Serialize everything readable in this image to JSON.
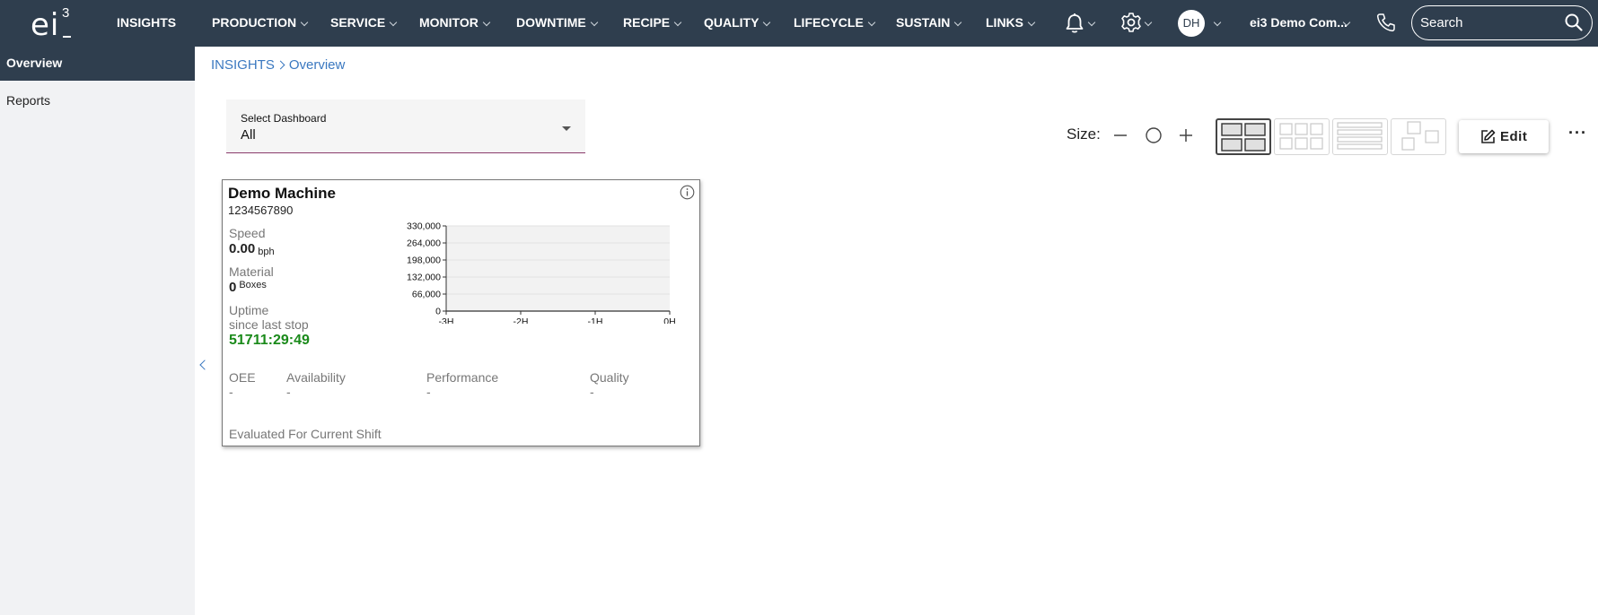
{
  "nav": {
    "brand_letters": "ei",
    "brand_superscript": "3",
    "items": [
      "INSIGHTS",
      "PRODUCTION",
      "SERVICE",
      "MONITOR",
      "DOWNTIME",
      "RECIPE",
      "QUALITY",
      "LIFECYCLE",
      "SUSTAIN",
      "LINKS"
    ],
    "avatar_initials": "DH",
    "company": "ei3 Demo Com...",
    "search_placeholder": "Search"
  },
  "sidebar": {
    "items": [
      "Overview",
      "Reports"
    ]
  },
  "breadcrumb": {
    "root": "INSIGHTS",
    "current": "Overview"
  },
  "dashboard_select": {
    "label": "Select Dashboard",
    "value": "All"
  },
  "toolbar": {
    "size_label": "Size:",
    "edit_label": "Edit",
    "more_label": "···"
  },
  "card": {
    "title": "Demo Machine",
    "serial": "1234567890",
    "speed_label": "Speed",
    "speed_value": "0.00",
    "speed_unit": "bph",
    "material_label": "Material",
    "material_value": "0",
    "material_unit": "Boxes",
    "uptime_label": "Uptime",
    "uptime_sub": "since last stop",
    "uptime_value": "51711:29:49",
    "oee": [
      {
        "label": "OEE",
        "value": "-"
      },
      {
        "label": "Availability",
        "value": "-"
      },
      {
        "label": "Performance",
        "value": "-"
      },
      {
        "label": "Quality",
        "value": "-"
      }
    ],
    "footnote": "Evaluated For Current Shift"
  },
  "chart_data": {
    "type": "line",
    "title": "",
    "xlabel": "",
    "ylabel": "",
    "x_ticks": [
      "-3H",
      "-2H",
      "-1H",
      "0H"
    ],
    "y_ticks": [
      "330,000",
      "264,000",
      "198,000",
      "132,000",
      "66,000",
      "0"
    ],
    "ylim": [
      0,
      330000
    ],
    "grid": true,
    "series": []
  },
  "colors": {
    "nav_bg": "#2f3e4e",
    "link": "#3a78c0",
    "uptime": "#1a8a1a",
    "select_underline": "#8a3b6b"
  }
}
